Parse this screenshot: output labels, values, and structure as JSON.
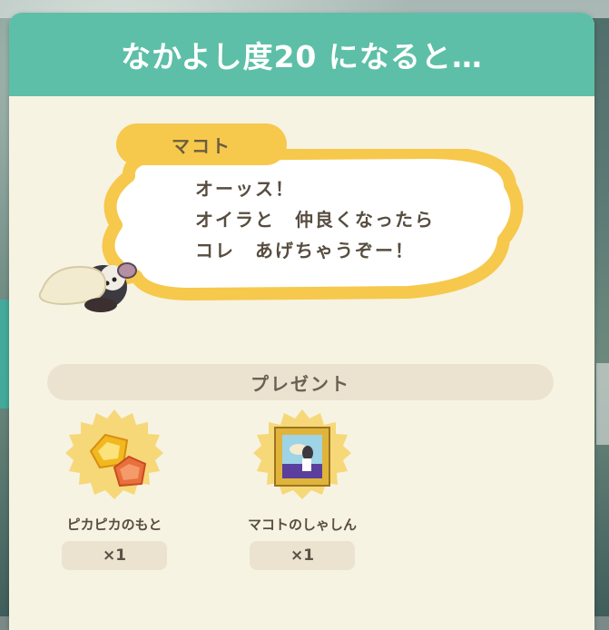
{
  "header": {
    "title": "なかよし度20 になると…"
  },
  "speaker": {
    "name": "マコト"
  },
  "dialogue": {
    "lines": [
      "オーッス！",
      "オイラと　仲良くなったら",
      "コレ　あげちゃうぞー！"
    ]
  },
  "present": {
    "label": "プレゼント",
    "items": [
      {
        "name": "ピカピカのもと",
        "qty": "×1",
        "icon": "sparkle-gem-icon"
      },
      {
        "name": "マコトのしゃしん",
        "qty": "×1",
        "icon": "framed-photo-icon"
      }
    ]
  },
  "colors": {
    "header": "#5dbfa7",
    "panel": "#f7f3e3",
    "bubble_outline": "#f6c84c",
    "badge": "#f6d878"
  }
}
